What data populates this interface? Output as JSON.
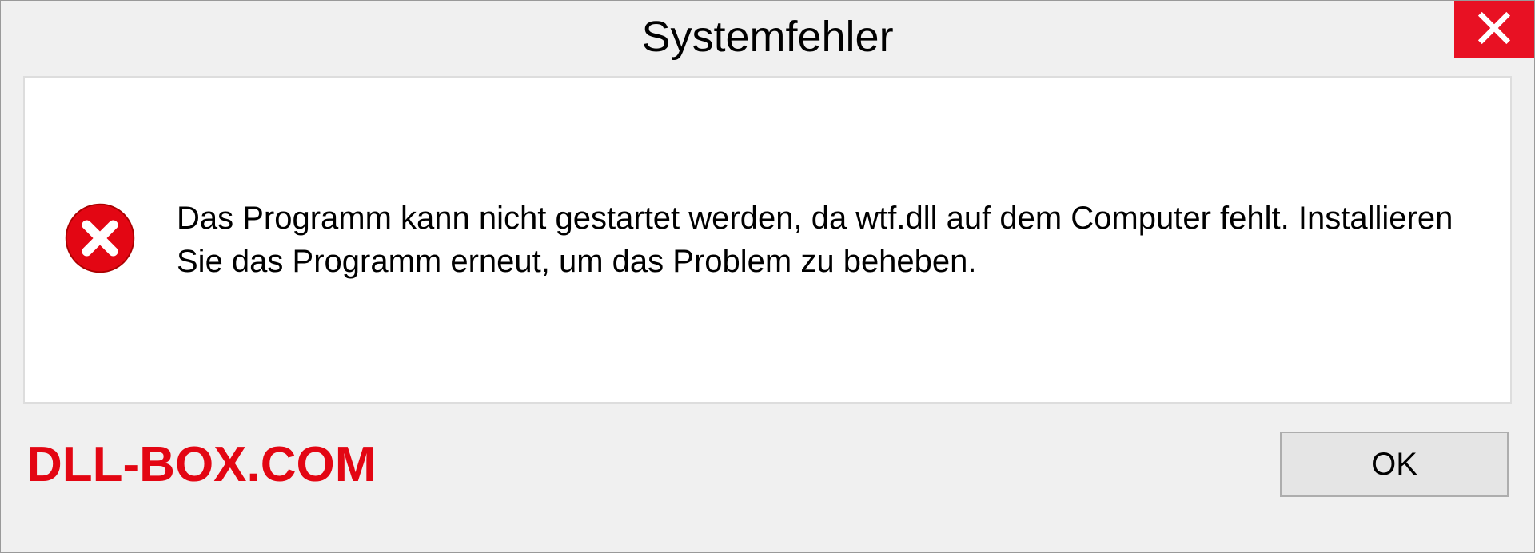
{
  "dialog": {
    "title": "Systemfehler",
    "message": "Das Programm kann nicht gestartet werden, da wtf.dll auf dem Computer fehlt. Installieren Sie das Programm erneut, um das Problem zu beheben.",
    "ok_label": "OK"
  },
  "watermark": "DLL-BOX.COM"
}
